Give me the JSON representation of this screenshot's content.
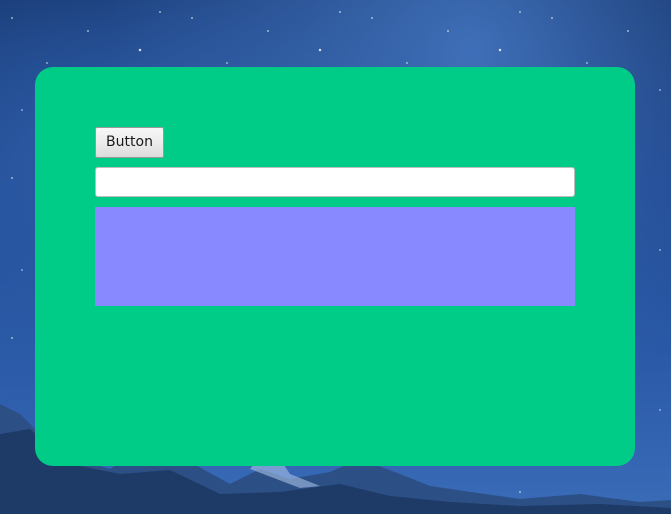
{
  "window": {
    "background_name": "starry-night-mountain-wallpaper",
    "panel_color": "#00cc88",
    "box_color": "#8888ff"
  },
  "form": {
    "button_label": "Button",
    "input_value": "",
    "input_placeholder": ""
  }
}
